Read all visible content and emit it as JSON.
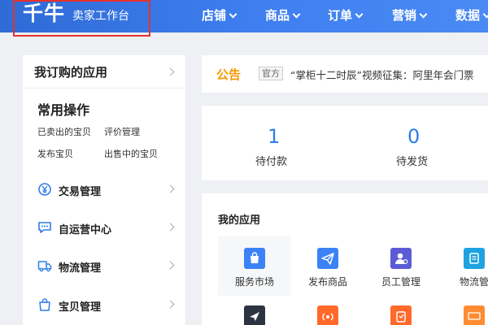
{
  "header": {
    "logo": "千牛",
    "subtitle": "卖家工作台",
    "nav": [
      "店铺",
      "商品",
      "订单",
      "营销",
      "数据"
    ]
  },
  "sidebar": {
    "title": "我订购的应用",
    "common_ops": {
      "title": "常用操作",
      "links": [
        "已卖出的宝贝",
        "评价管理",
        "发布宝贝",
        "出售中的宝贝"
      ]
    },
    "items": [
      {
        "label": "交易管理",
        "icon": "yen-circle-icon"
      },
      {
        "label": "自运营中心",
        "icon": "chat-bubble-icon"
      },
      {
        "label": "物流管理",
        "icon": "truck-icon"
      },
      {
        "label": "宝贝管理",
        "icon": "shopping-bag-icon"
      }
    ]
  },
  "announcement": {
    "title": "公告",
    "tag": "官方",
    "text": "“掌柜十二时辰”视频征集：阿里年会门票"
  },
  "stats": [
    {
      "value": "1",
      "label": "待付款"
    },
    {
      "value": "0",
      "label": "待发货"
    }
  ],
  "apps": {
    "title": "我的应用",
    "items": [
      {
        "label": "服务市场",
        "icon": "market-bag-icon",
        "color": "#3b82f6"
      },
      {
        "label": "发布商品",
        "icon": "paper-plane-icon",
        "color": "#3b82f6"
      },
      {
        "label": "员工管理",
        "icon": "employee-icon",
        "color": "#5b5bd6"
      },
      {
        "label": "物流管",
        "icon": "logistics-icon",
        "color": "#1fa2e0"
      }
    ]
  },
  "colors": {
    "header_start": "#2f6bd6",
    "header_end": "#4a8af4",
    "accent_blue": "#2f7ce8",
    "announce_orange": "#f39800"
  }
}
